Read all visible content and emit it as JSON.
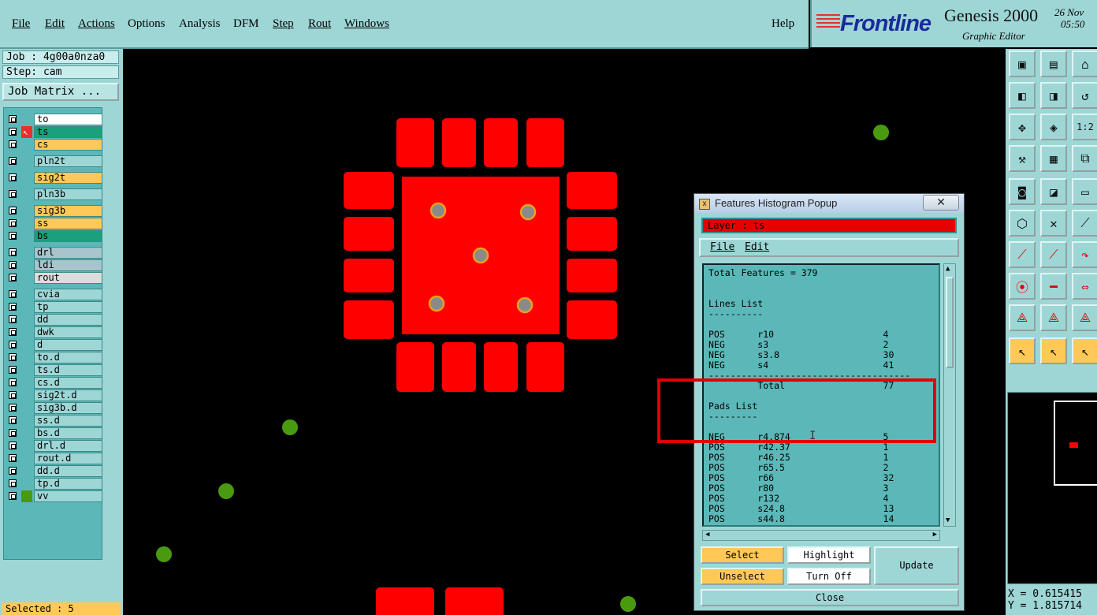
{
  "menubar": {
    "items": [
      "File",
      "Edit",
      "Actions",
      "Options",
      "Analysis",
      "DFM",
      "Step",
      "Rout",
      "Windows"
    ],
    "help": "Help"
  },
  "brand": {
    "logo": "Frontline",
    "product": "Genesis 2000",
    "subtitle": "Graphic Editor",
    "date": "26 Nov",
    "time": "05:50"
  },
  "left": {
    "job": "Job : 4g00a0nza0",
    "step": "Step: cam",
    "job_matrix": "Job Matrix ...",
    "layers": [
      {
        "name": "to",
        "color": "#ffffff"
      },
      {
        "name": "ts",
        "color": "#1aa07a"
      },
      {
        "name": "cs",
        "color": "#ffc857"
      },
      {
        "name": "pln2t",
        "color": "#9ed6d6"
      },
      {
        "name": "sig2t",
        "color": "#ffc857"
      },
      {
        "name": "pln3b",
        "color": "#9ed6d6"
      },
      {
        "name": "sig3b",
        "color": "#ffc857"
      },
      {
        "name": "ss",
        "color": "#ffc857"
      },
      {
        "name": "bs",
        "color": "#1aa07a"
      },
      {
        "name": "drl",
        "color": "#a8c4cc"
      },
      {
        "name": "ldi",
        "color": "#a8c4cc"
      },
      {
        "name": "rout",
        "color": "#dcdcdc"
      },
      {
        "name": "cvia",
        "color": "#9ed6d6"
      },
      {
        "name": "tp",
        "color": "#9ed6d6"
      },
      {
        "name": "dd",
        "color": "#9ed6d6"
      },
      {
        "name": "dwk",
        "color": "#9ed6d6"
      },
      {
        "name": "d",
        "color": "#9ed6d6"
      },
      {
        "name": "to.d",
        "color": "#9ed6d6"
      },
      {
        "name": "ts.d",
        "color": "#9ed6d6"
      },
      {
        "name": "cs.d",
        "color": "#9ed6d6"
      },
      {
        "name": "sig2t.d",
        "color": "#9ed6d6"
      },
      {
        "name": "sig3b.d",
        "color": "#9ed6d6"
      },
      {
        "name": "ss.d",
        "color": "#9ed6d6"
      },
      {
        "name": "bs.d",
        "color": "#9ed6d6"
      },
      {
        "name": "drl.d",
        "color": "#9ed6d6"
      },
      {
        "name": "rout.d",
        "color": "#9ed6d6"
      },
      {
        "name": "dd.d",
        "color": "#9ed6d6"
      },
      {
        "name": "tp.d",
        "color": "#9ed6d6"
      },
      {
        "name": "vv",
        "color": "#9ed6d6"
      }
    ],
    "selected": "Selected : 5"
  },
  "right": {
    "coord_x": "X = 0.615415",
    "coord_y": "Y = 1.815714"
  },
  "popup": {
    "title": "Features Histogram Popup",
    "close_x": "✕",
    "layer": "Layer :  ts",
    "menu_file": "File",
    "menu_edit": "Edit",
    "list_text": "Total Features = 379\n\n\nLines List\n----------\n\nPOS      r10                    4\nNEG      s3                     2\nNEG      s3.8                   30\nNEG      s4                     41\n-------------------------------------\n         Total                  77\n\nPads List\n---------\n\nNEG      r4.874                 5\nPOS      r42.37                 1\nPOS      r46.25                 1\nPOS      r65.5                  2\nPOS      r66                    32\nPOS      r80                    3\nPOS      r132                   4\nPOS      s24.8                  13\nPOS      s44.8                  14",
    "buttons": {
      "select": "Select",
      "unselect": "Unselect",
      "highlight": "Highlight",
      "turn_off": "Turn Off",
      "update": "Update",
      "close": "Close"
    }
  },
  "colors": {
    "panel": "#9ed6d6",
    "pad": "#ff0000",
    "via": "#4a9a10",
    "hole_ring": "#e8a020"
  }
}
